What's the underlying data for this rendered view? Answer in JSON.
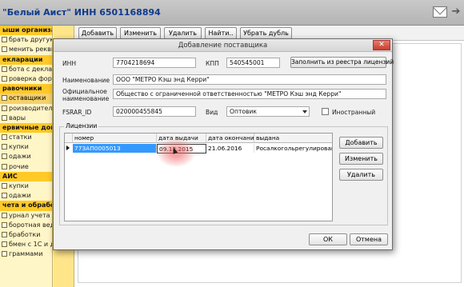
{
  "app": {
    "title": "\"Белый Аист\" ИНН 6501168894",
    "icons": [
      "mail-icon",
      "exit-icon"
    ]
  },
  "sidebar": {
    "items": [
      {
        "label": "ыши организации",
        "kind": "header"
      },
      {
        "label": "брать другую",
        "kind": "item"
      },
      {
        "label": "менить реквизиты",
        "kind": "item"
      },
      {
        "label": "екларации",
        "kind": "header"
      },
      {
        "label": "бота с деклараци",
        "kind": "item"
      },
      {
        "label": "роверка формата",
        "kind": "item"
      },
      {
        "label": "равочники",
        "kind": "header"
      },
      {
        "label": "оставщики",
        "kind": "selected"
      },
      {
        "label": "роизводители",
        "kind": "item"
      },
      {
        "label": "вары",
        "kind": "item"
      },
      {
        "label": "ервичные докуме",
        "kind": "header"
      },
      {
        "label": "статки",
        "kind": "item"
      },
      {
        "label": "купки",
        "kind": "item"
      },
      {
        "label": "одажи",
        "kind": "item"
      },
      {
        "label": "рочие",
        "kind": "item"
      },
      {
        "label": "АИС",
        "kind": "header"
      },
      {
        "label": "купки",
        "kind": "item"
      },
      {
        "label": "одажи",
        "kind": "item"
      },
      {
        "label": "чета и обработк",
        "kind": "header"
      },
      {
        "label": "урнал учета алкоп",
        "kind": "item"
      },
      {
        "label": "боротная ведомос",
        "kind": "item"
      },
      {
        "label": "бработки",
        "kind": "item"
      },
      {
        "label": "бмен с 1С и другими",
        "kind": "item"
      },
      {
        "label": "граммами",
        "kind": "item"
      }
    ]
  },
  "toolbar": {
    "add_label": "Добавить",
    "edit_label": "Изменить",
    "delete_label": "Удалить",
    "find_label": "Найти..",
    "remove_dup_label": "Убрать дубль"
  },
  "dialog": {
    "title": "Добавление поставщика",
    "inn_label": "ИНН",
    "inn_value": "7704218694",
    "kpp_label": "КПП",
    "kpp_value": "540545001",
    "fill_button": "Заполнить из реестра лицензий",
    "name_label": "Наименование",
    "name_value": "ООО \"МЕТРО Кэш энд Керри\"",
    "official_name_label_1": "Официальное",
    "official_name_label_2": "наименование",
    "official_name_value": "Общество с ограниченной ответственностью \"МЕТРО Кэш энд Керри\"",
    "fsrar_label": "FSRAR_ID",
    "fsrar_value": "020000455845",
    "kind_label": "Вид",
    "kind_value": "Оптовик",
    "foreign_label": "Иностранный",
    "foreign_checked": false,
    "licenses_legend": "Лицензии",
    "licenses": {
      "columns": [
        "номер",
        "дата выдачи",
        "дата окончания",
        "выдана"
      ],
      "rows": [
        {
          "number": "77ЗАП0005013",
          "issued": "09.12.2015",
          "expires": "21.06.2016",
          "issuer": "Росалкогольрегулирование"
        }
      ]
    },
    "lic_add": "Добавить",
    "lic_edit": "Изменить",
    "lic_delete": "Удалить",
    "ok": "ОК",
    "cancel": "Отмена",
    "close": "✕"
  },
  "colors": {
    "sidebar_bg": "#fff6c8",
    "sidebar_header": "#ffc928",
    "title_text": "#103a8e",
    "selection": "#3399ff",
    "close_button": "#c4402e"
  }
}
